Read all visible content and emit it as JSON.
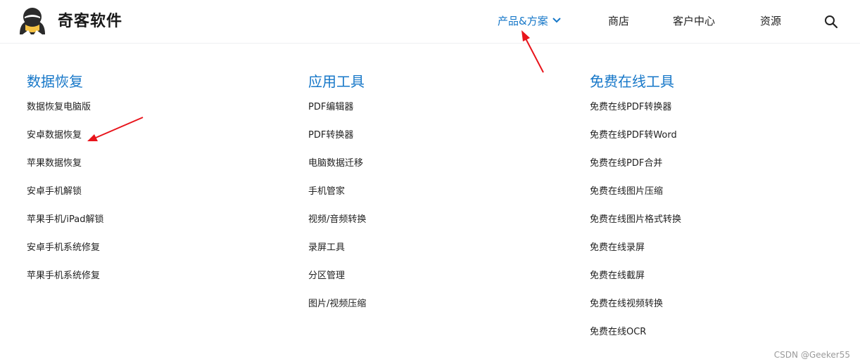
{
  "brand": {
    "name": "奇客软件",
    "logo_icon": "penguin-logo-icon"
  },
  "nav": {
    "items": [
      {
        "label": "产品&方案",
        "active": true,
        "icon": "chevron-down-icon"
      },
      {
        "label": "商店"
      },
      {
        "label": "客户中心"
      },
      {
        "label": "资源"
      }
    ],
    "search_icon": "search-icon"
  },
  "menu": {
    "columns": [
      {
        "title": "数据恢复",
        "items": [
          "数据恢复电脑版",
          "安卓数据恢复",
          "苹果数据恢复",
          "安卓手机解锁",
          "苹果手机/iPad解锁",
          "安卓手机系统修复",
          "苹果手机系统修复"
        ]
      },
      {
        "title": "应用工具",
        "items": [
          "PDF编辑器",
          "PDF转换器",
          "电脑数据迁移",
          "手机管家",
          "视频/音频转换",
          "录屏工具",
          "分区管理",
          "图片/视频压缩"
        ]
      },
      {
        "title": "免费在线工具",
        "items": [
          "免费在线PDF转换器",
          "免费在线PDF转Word",
          "免费在线PDF合并",
          "免费在线图片压缩",
          "免费在线图片格式转换",
          "免费在线录屏",
          "免费在线截屏",
          "免费在线视频转换",
          "免费在线OCR"
        ]
      }
    ]
  },
  "watermark": "CSDN @Geeker55",
  "colors": {
    "accent": "#1677c8",
    "annotation": "#e8141b"
  }
}
